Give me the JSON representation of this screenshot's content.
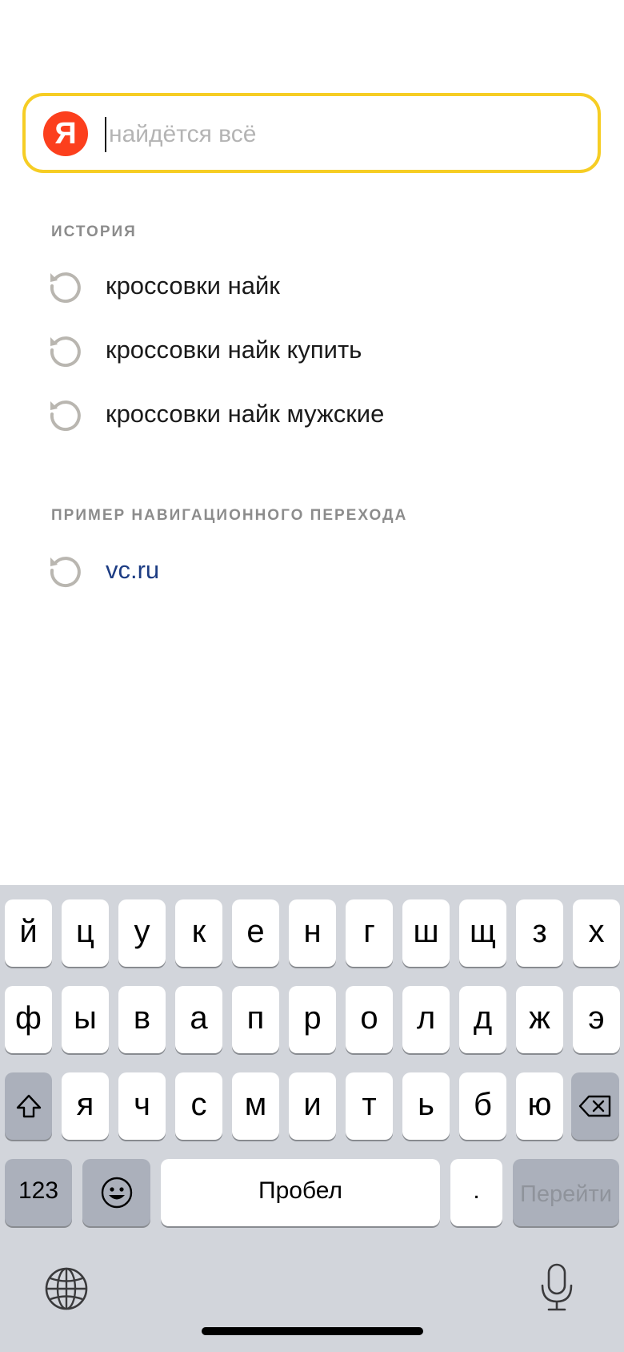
{
  "search": {
    "logo_letter": "Я",
    "placeholder": "найдётся всё",
    "value": ""
  },
  "history": {
    "title": "ИСТОРИЯ",
    "items": [
      {
        "label": "кроссовки найк"
      },
      {
        "label": "кроссовки найк купить"
      },
      {
        "label": "кроссовки найк мужские"
      }
    ]
  },
  "navigation": {
    "title": "ПРИМЕР НАВИГАЦИОННОГО ПЕРЕХОДА",
    "items": [
      {
        "label": "vc.ru"
      }
    ]
  },
  "keyboard": {
    "row1": [
      "й",
      "ц",
      "у",
      "к",
      "е",
      "н",
      "г",
      "ш",
      "щ",
      "з",
      "х"
    ],
    "row2": [
      "ф",
      "ы",
      "в",
      "а",
      "п",
      "р",
      "о",
      "л",
      "д",
      "ж",
      "э"
    ],
    "row3": [
      "я",
      "ч",
      "с",
      "м",
      "и",
      "т",
      "ь",
      "б",
      "ю"
    ],
    "numbers_label": "123",
    "space_label": "Пробел",
    "period_label": ".",
    "go_label": "Перейти"
  },
  "colors": {
    "search_border": "#f6cd24",
    "logo_bg": "#fc3f1d",
    "nav_link": "#1c3c83",
    "keyboard_bg": "#d2d5db"
  },
  "icons": [
    "history-icon",
    "shift-icon",
    "backspace-icon",
    "emoji-icon",
    "globe-icon",
    "microphone-icon"
  ]
}
